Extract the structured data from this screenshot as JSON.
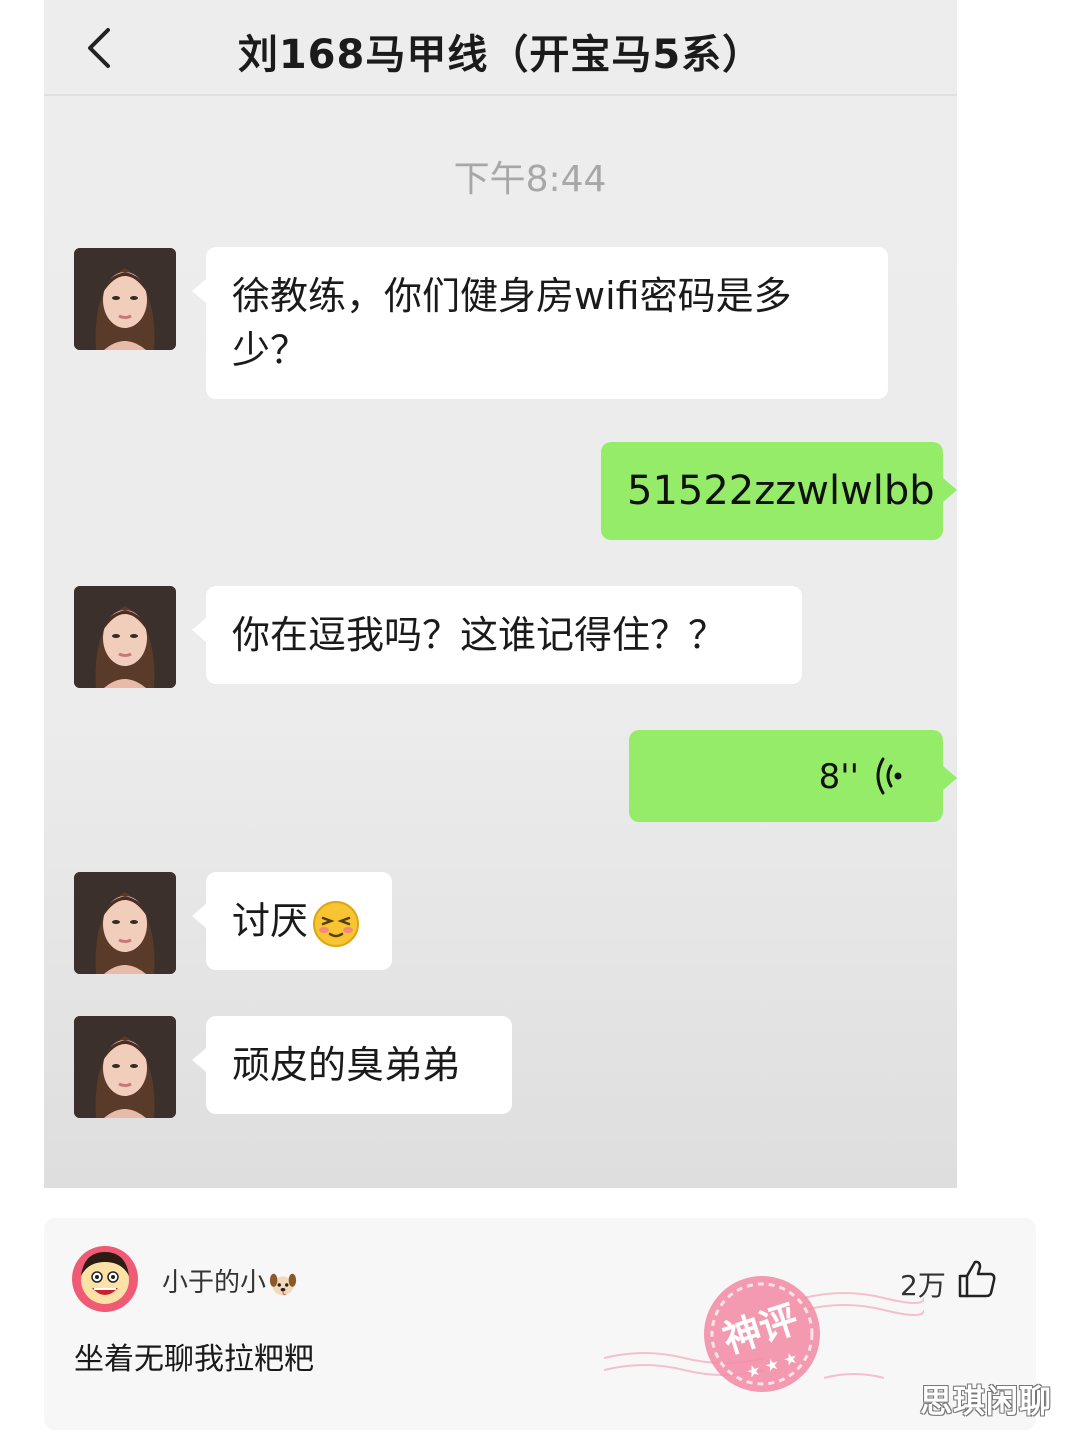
{
  "chat": {
    "title": "刘168马甲线（开宝马5系）",
    "timestamp": "下午8:44",
    "messages": [
      {
        "side": "in",
        "text": "徐教练，你们健身房wifi密码是多少？"
      },
      {
        "side": "out",
        "text": "51522zzwlwlbb"
      },
      {
        "side": "in",
        "text": "你在逗我吗？这谁记得住？？"
      },
      {
        "side": "out",
        "type": "voice",
        "duration": "8''"
      },
      {
        "side": "in",
        "text": "讨厌",
        "emoji": "embarrassed-emoji"
      },
      {
        "side": "in",
        "text": "顽皮的臭弟弟"
      }
    ]
  },
  "comment": {
    "username": "小于的小",
    "username_emoji": "dog-emoji",
    "text": "坐着无聊我拉粑粑",
    "like_count": "2万",
    "stamp_text": "神评"
  },
  "watermark": "思琪闲聊",
  "colors": {
    "chat_bg": "#ededed",
    "bubble_in": "#ffffff",
    "bubble_out": "#95ec69",
    "stamp": "#f06b8a"
  }
}
